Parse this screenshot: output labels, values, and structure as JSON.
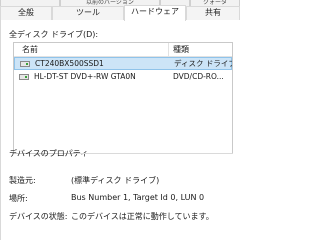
{
  "tabs_top": [
    "",
    "以前のバージョン",
    "",
    "クォータ"
  ],
  "tabs": [
    "全般",
    "ツール",
    "ハードウェア",
    "共有"
  ],
  "active_tab": "ハードウェア",
  "disk_section_label": "全ディスク ドライブ(D):",
  "list": {
    "headers": [
      "名前",
      "種類"
    ],
    "rows": [
      {
        "name": "CT240BX500SSD1",
        "type": "ディスク ドライブ",
        "selected": true,
        "icon": "hard-drive-icon"
      },
      {
        "name": "HL-DT-ST DVD+-RW GTA0N",
        "type": "DVD/CD-RO...",
        "selected": false,
        "icon": "optical-drive-icon"
      }
    ]
  },
  "properties": {
    "title": "デバイスのプロパティ",
    "items": [
      {
        "label": "製造元:",
        "value": "(標準ディスク ドライブ)"
      },
      {
        "label": "場所:",
        "value": "Bus Number 1, Target Id 0, LUN 0"
      },
      {
        "label": "デバイスの状態:",
        "value": "このデバイスは正常に動作しています。"
      }
    ]
  },
  "colors": {
    "selection": "#cce4f7",
    "selection_border": "#8fc3ea",
    "border": "#d9d9d9"
  }
}
